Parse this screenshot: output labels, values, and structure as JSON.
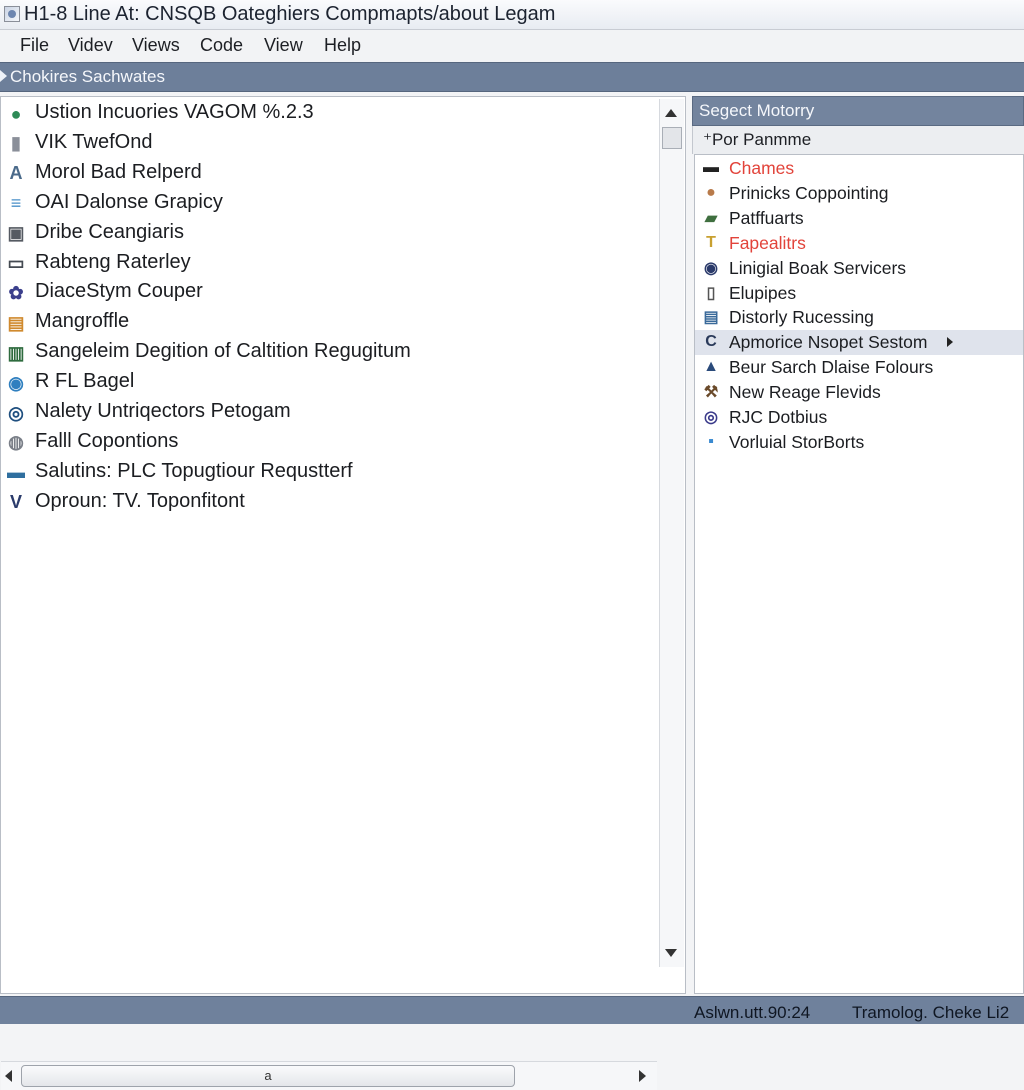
{
  "window": {
    "title": "H1-8 Line At: CNSQB Oateghiers Compmapts/about Legam"
  },
  "menu": [
    "File",
    "Videv",
    "Views",
    "Code",
    "View",
    "Help"
  ],
  "left_header": "Chokires Sachwates",
  "left_items": [
    {
      "label": "Ustion Incuories VAGOM  %.2.3",
      "icon": "globe-icon",
      "glyph": "●",
      "color": "#2e8b57"
    },
    {
      "label": "VIK TwefOnd",
      "icon": "battery-icon",
      "glyph": "▮",
      "color": "#8a8f99"
    },
    {
      "label": "Morol Bad Relperd",
      "icon": "triangle-icon",
      "glyph": "A",
      "color": "#4a6a8a"
    },
    {
      "label": "OAI Dalonse Grapicy",
      "icon": "database-icon",
      "glyph": "≡",
      "color": "#4a90c8"
    },
    {
      "label": "Dribe Ceangiaris",
      "icon": "drive-icon",
      "glyph": "▣",
      "color": "#555a62"
    },
    {
      "label": "Rabteng Raterley",
      "icon": "window-icon",
      "glyph": "▭",
      "color": "#444a52"
    },
    {
      "label": "DiaceStym Couper",
      "icon": "gear-icon",
      "glyph": "✿",
      "color": "#3b3f8c"
    },
    {
      "label": "Mangroffle",
      "icon": "image-icon",
      "glyph": "▤",
      "color": "#d08a2e"
    },
    {
      "label": "Sangeleim Degition of Caltition Regugitum",
      "icon": "chart-icon",
      "glyph": "▥",
      "color": "#2e6b3e"
    },
    {
      "label": "R FL Bagel",
      "icon": "earth-icon",
      "glyph": "◉",
      "color": "#2f7fbf"
    },
    {
      "label": "Nalety Untriqectors Petogam",
      "icon": "disc-icon",
      "glyph": "◎",
      "color": "#1f4f7f"
    },
    {
      "label": "Falll Copontions",
      "icon": "clock-icon",
      "glyph": "◍",
      "color": "#7a7f88"
    },
    {
      "label": "Salutins: PLC Topugtiour Requstterf",
      "icon": "monitor-icon",
      "glyph": "▬",
      "color": "#2f6f9f"
    },
    {
      "label": "Oproun: TV. Toponfitont",
      "icon": "antenna-icon",
      "glyph": "V",
      "color": "#2b3b6b"
    }
  ],
  "hscroll_label": "a",
  "right_header": "Segect Motorry",
  "right_sub": "⁺Por Panmme",
  "right_items": [
    {
      "label": "Chames",
      "icon": "terminal-icon",
      "glyph": "▬",
      "color": "#222",
      "red": true
    },
    {
      "label": "Prinicks Coppointing",
      "icon": "person-icon",
      "glyph": "●",
      "color": "#b87a4a",
      "red": false
    },
    {
      "label": "Patffuarts",
      "icon": "car-icon",
      "glyph": "▰",
      "color": "#3f6f3f",
      "red": false
    },
    {
      "label": "Fapealitrs",
      "icon": "tools-icon",
      "glyph": "T",
      "color": "#c8a030",
      "red": true
    },
    {
      "label": "Linigial Boak Servicers",
      "icon": "globe-icon",
      "glyph": "◉",
      "color": "#2a3a6a",
      "red": false
    },
    {
      "label": "Elupipes",
      "icon": "document-icon",
      "glyph": "▯",
      "color": "#555",
      "red": false
    },
    {
      "label": "Distorly Rucessing",
      "icon": "screen-icon",
      "glyph": "▤",
      "color": "#3a6a9a",
      "red": false
    },
    {
      "label": "Apmorice Nsopet Sestom",
      "icon": "c-letter-icon",
      "glyph": "C",
      "color": "#2a3a5a",
      "red": false,
      "selected": true,
      "submenu": true
    },
    {
      "label": "Beur Sarch Dlaise Folours",
      "icon": "warning-icon",
      "glyph": "▲",
      "color": "#2a4a7a",
      "red": false
    },
    {
      "label": "New Reage Flevids",
      "icon": "hammer-icon",
      "glyph": "⚒",
      "color": "#6a4a2a",
      "red": false
    },
    {
      "label": "RJC Dotbius",
      "icon": "target-icon",
      "glyph": "◎",
      "color": "#3a3a8a",
      "red": false
    },
    {
      "label": "Vorluial StorBorts",
      "icon": "app-icon",
      "glyph": "▪",
      "color": "#3a8ad0",
      "red": false
    }
  ],
  "status": {
    "left": "Aslwn.utt.90:24",
    "right": "Tramolog. Cheke Li2"
  }
}
